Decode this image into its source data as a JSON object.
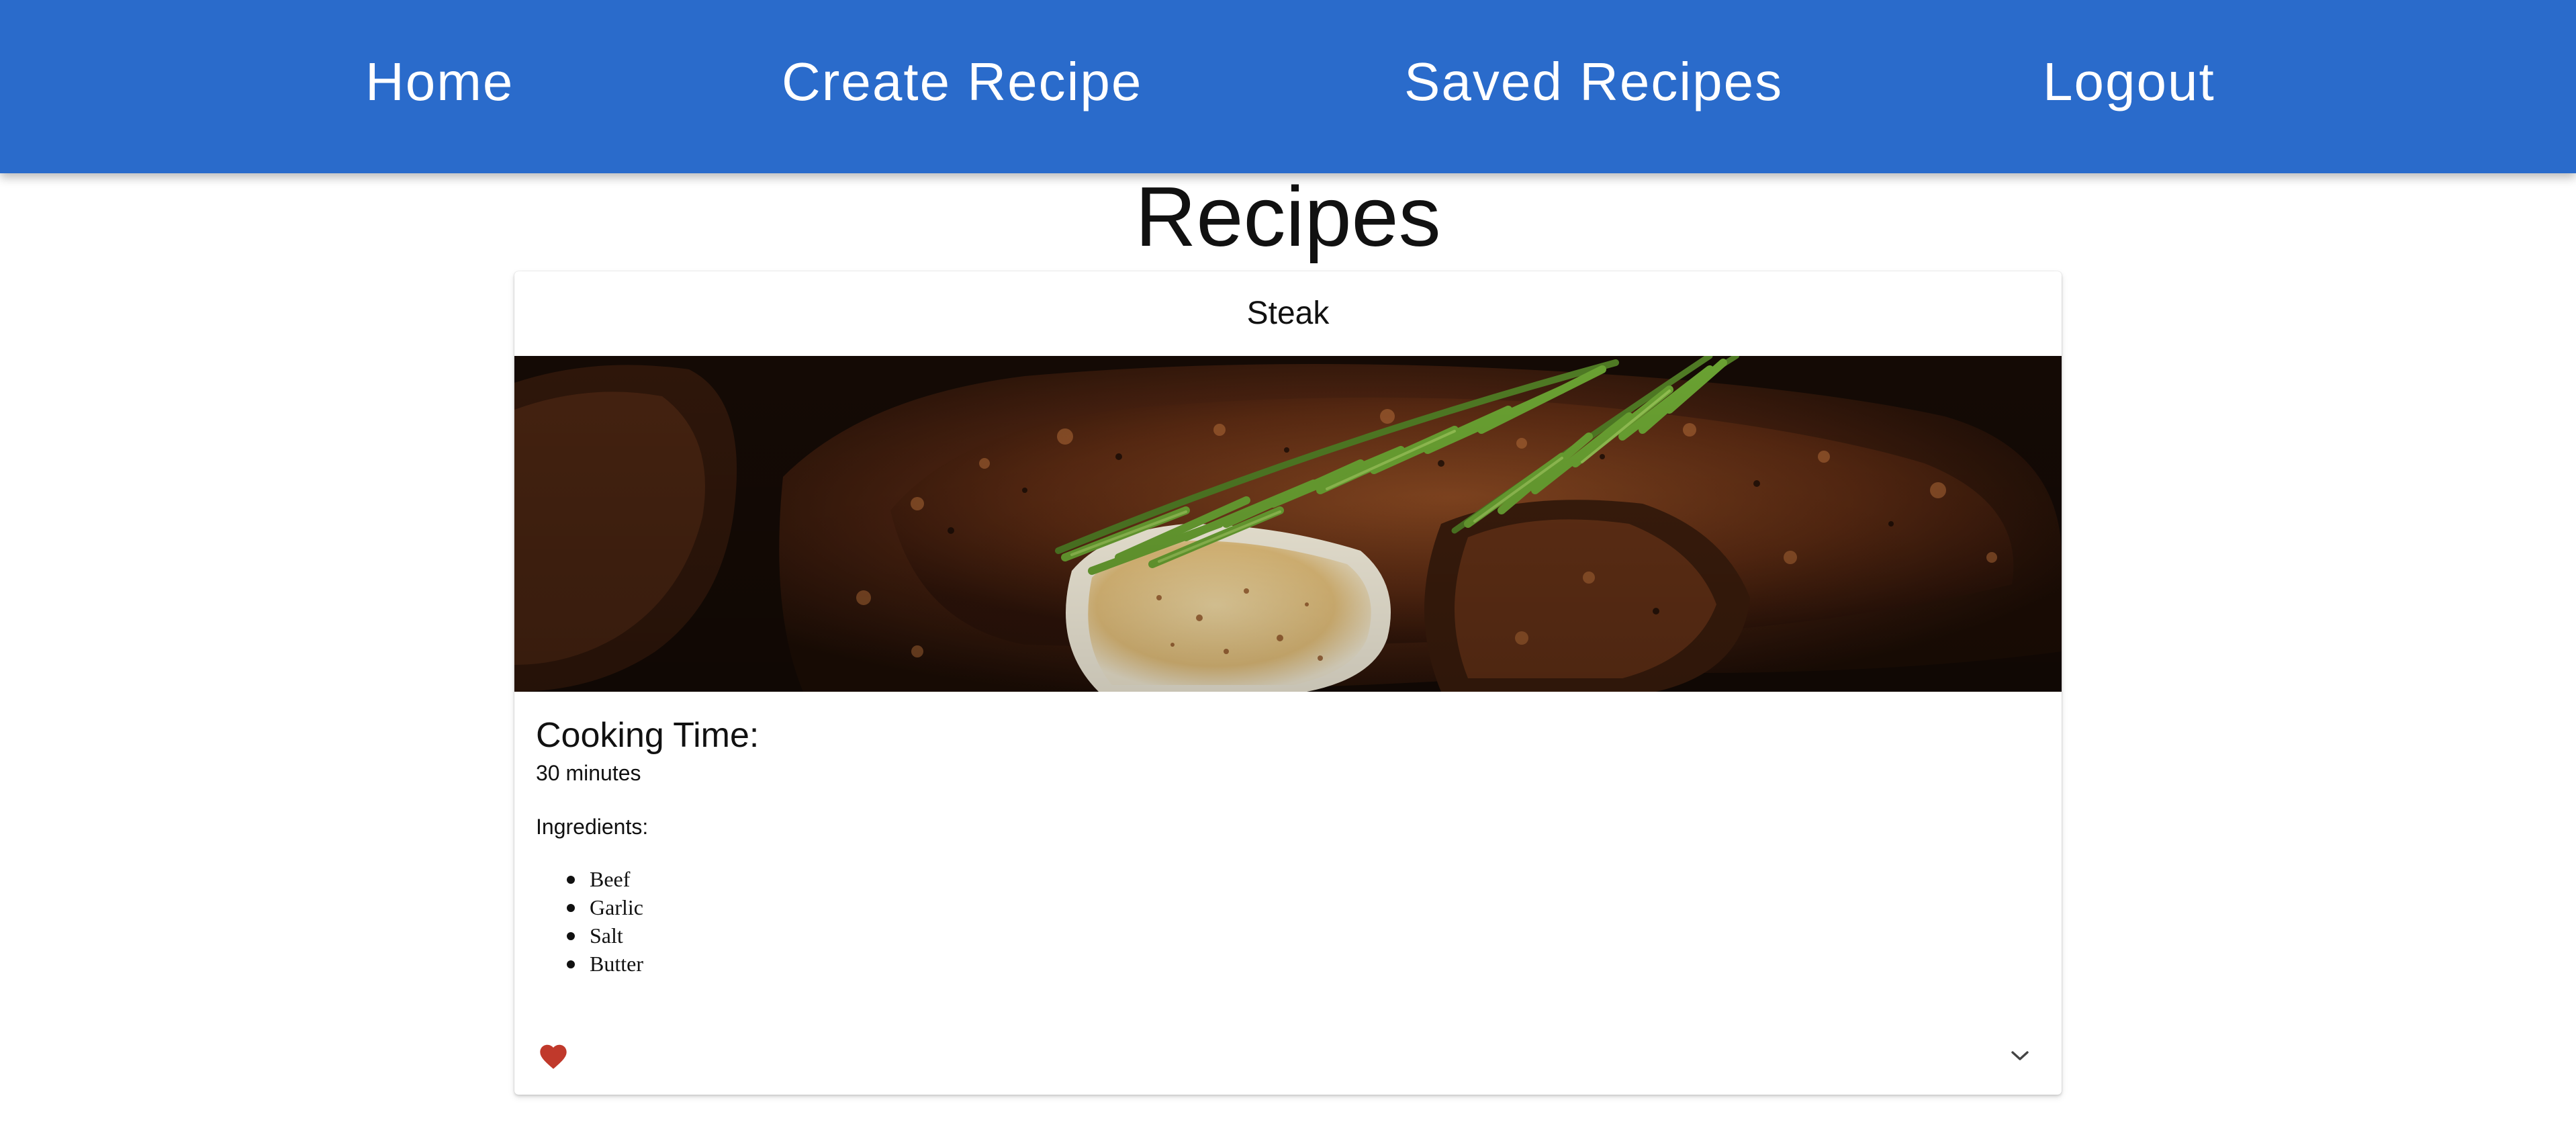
{
  "nav": {
    "home": "Home",
    "create_recipe": "Create Recipe",
    "saved_recipes": "Saved Recipes",
    "logout": "Logout",
    "background_color": "#2a6bcb"
  },
  "page": {
    "title": "Recipes"
  },
  "recipe": {
    "name": "Steak",
    "image_icon": "steak-photo",
    "cooking_time_label": "Cooking Time:",
    "cooking_time": "30 minutes",
    "ingredients_label": "Ingredients:",
    "ingredients": [
      "Beef",
      "Garlic",
      "Salt",
      "Butter"
    ],
    "favorite_icon": "heart-icon",
    "favorite_color": "#c0392b",
    "expand_icon": "chevron-down-icon"
  }
}
